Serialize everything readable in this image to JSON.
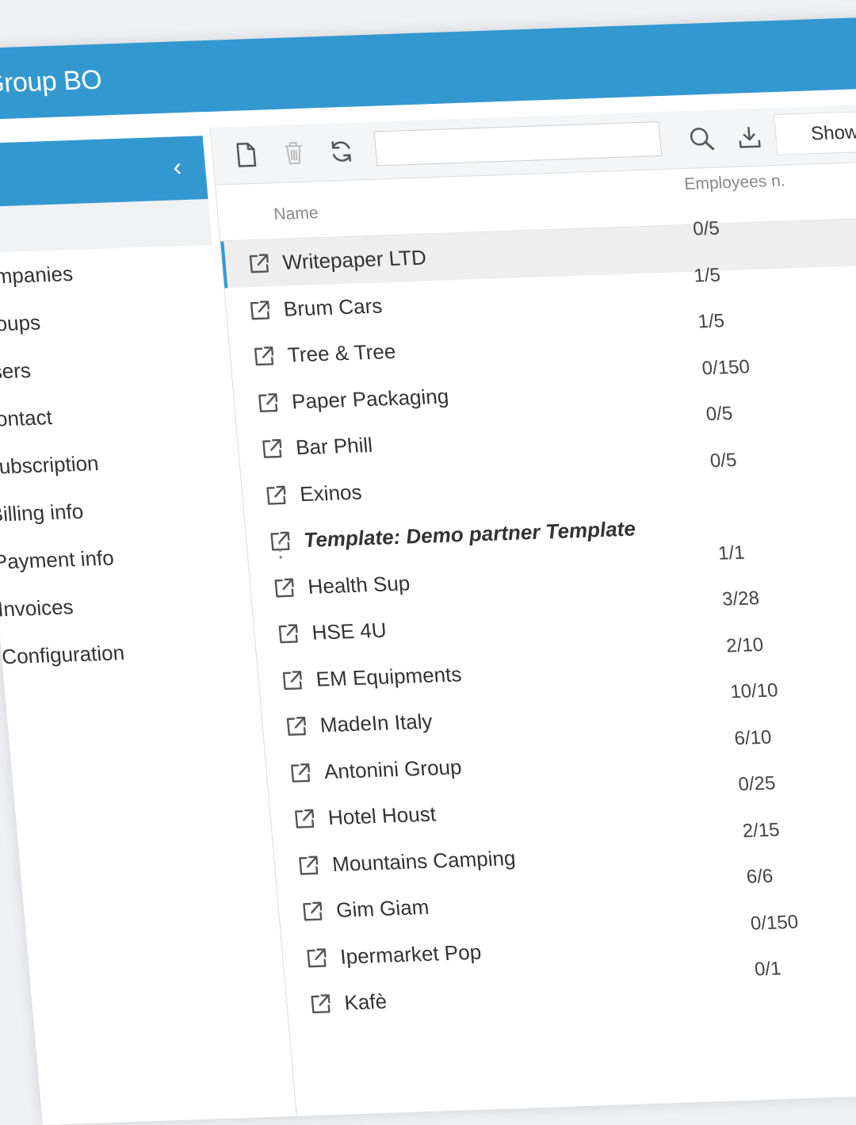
{
  "app": {
    "title": "Group BO"
  },
  "sidebar": {
    "collapse_icon": "chevron-left-icon",
    "items": [
      {
        "label": "Companies"
      },
      {
        "label": "Groups"
      },
      {
        "label": "Users"
      },
      {
        "label": "Contact"
      },
      {
        "label": "Subscription"
      },
      {
        "label": "Billing info"
      },
      {
        "label": "Payment info"
      },
      {
        "label": "Invoices"
      },
      {
        "label": "Configuration"
      }
    ]
  },
  "toolbar": {
    "new_icon": "file-icon",
    "delete_icon": "trash-icon",
    "refresh_icon": "refresh-icon",
    "search_value": "",
    "search_icon": "search-icon",
    "export_icon": "download-icon",
    "show_label": "Show"
  },
  "grid": {
    "columns": {
      "name": "Name",
      "employees": "Employees n."
    },
    "rows": [
      {
        "name": "Writepaper LTD",
        "employees": "0/5"
      },
      {
        "name": "Brum Cars",
        "employees": "1/5"
      },
      {
        "name": "Tree & Tree",
        "employees": "1/5"
      },
      {
        "name": "Paper Packaging",
        "employees": "0/150"
      },
      {
        "name": "Bar Phill",
        "employees": "0/5"
      },
      {
        "name": "Exinos",
        "employees": "0/5"
      },
      {
        "name": "Template: Demo partner Template",
        "employees": ""
      },
      {
        "name": "Health Sup",
        "employees": "1/1"
      },
      {
        "name": "HSE 4U",
        "employees": "3/28"
      },
      {
        "name": "EM Equipments",
        "employees": "2/10"
      },
      {
        "name": "MadeIn Italy",
        "employees": "10/10"
      },
      {
        "name": "Antonini Group",
        "employees": "6/10"
      },
      {
        "name": "Hotel Houst",
        "employees": "0/25"
      },
      {
        "name": "Mountains Camping",
        "employees": "2/15"
      },
      {
        "name": "Gim Giam",
        "employees": "6/6"
      },
      {
        "name": "Ipermarket Pop",
        "employees": "0/150"
      },
      {
        "name": "Kafè",
        "employees": "0/1"
      }
    ]
  },
  "colors": {
    "accent": "#3498d0",
    "selected_row": "#eeeeee"
  }
}
